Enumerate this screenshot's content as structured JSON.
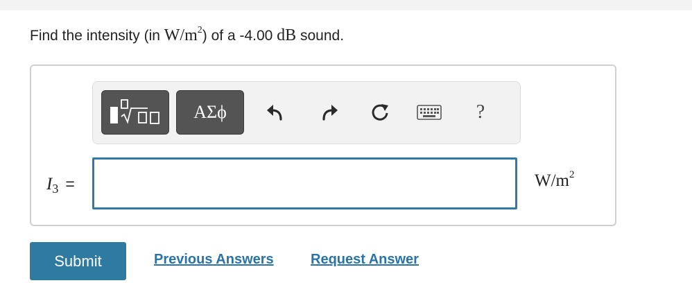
{
  "question": {
    "prefix": "Find the intensity (in ",
    "unit_main": "W/m",
    "unit_exp": "2",
    "middle": ") of a -4.00 ",
    "db_unit": "dB",
    "suffix": " sound."
  },
  "toolbar": {
    "templates_icon": "fraction-sqrt-template-icon",
    "symbols_label": "ΑΣϕ",
    "undo_icon": "undo-icon",
    "redo_icon": "redo-icon",
    "reset_icon": "reset-icon",
    "keyboard_icon": "keyboard-icon",
    "help_label": "?"
  },
  "answer": {
    "variable": "I",
    "subscript": "3",
    "equals": "=",
    "value": "",
    "unit_main": "W/m",
    "unit_exp": "2"
  },
  "actions": {
    "submit_label": "Submit",
    "previous_answers_label": "Previous Answers",
    "request_answer_label": "Request Answer"
  },
  "colors": {
    "accent": "#2f7aa0",
    "link": "#2a73a8",
    "input_border": "#2f7aa9",
    "toolbar_button": "#545454"
  }
}
